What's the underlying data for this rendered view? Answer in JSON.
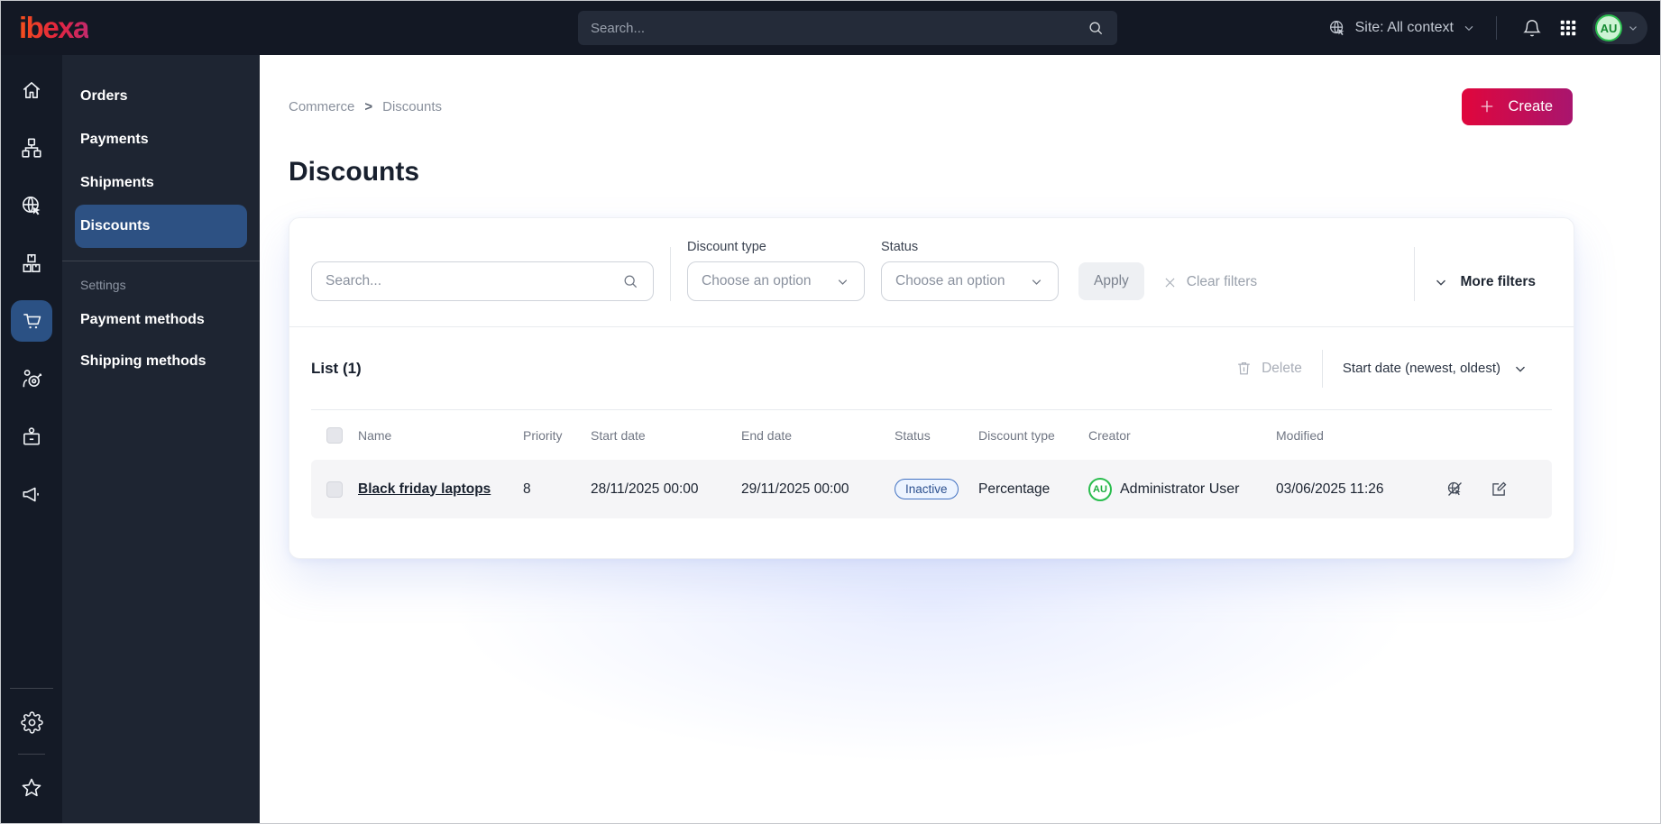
{
  "topbar": {
    "logo": "ibexa",
    "search_placeholder": "Search...",
    "site_context": "Site: All context",
    "avatar_initials": "AU"
  },
  "main_nav": {
    "items": [
      {
        "icon": "home-icon"
      },
      {
        "icon": "content-tree-icon"
      },
      {
        "icon": "site-icon"
      },
      {
        "icon": "products-icon"
      },
      {
        "icon": "commerce-cart-icon",
        "active": true
      },
      {
        "icon": "customers-target-icon"
      },
      {
        "icon": "corporate-badge-icon"
      },
      {
        "icon": "marketing-megaphone-icon"
      }
    ],
    "bottom_items": [
      {
        "icon": "settings-gear-icon"
      },
      {
        "icon": "bookmarks-star-icon"
      }
    ]
  },
  "sidebar": {
    "items": [
      {
        "label": "Orders"
      },
      {
        "label": "Payments"
      },
      {
        "label": "Shipments"
      },
      {
        "label": "Discounts",
        "active": true
      }
    ],
    "section_label": "Settings",
    "settings_items": [
      {
        "label": "Payment methods"
      },
      {
        "label": "Shipping methods"
      }
    ]
  },
  "breadcrumb": {
    "items": [
      "Commerce",
      "Discounts"
    ],
    "separator": ">"
  },
  "page": {
    "title": "Discounts",
    "create_label": "Create"
  },
  "filters": {
    "search_placeholder": "Search...",
    "discount_type_label": "Discount type",
    "discount_type_value": "Choose an option",
    "status_label": "Status",
    "status_value": "Choose an option",
    "apply_label": "Apply",
    "clear_label": "Clear filters",
    "more_filters_label": "More filters"
  },
  "list": {
    "title": "List (1)",
    "delete_label": "Delete",
    "sort_label": "Start date (newest, oldest)",
    "columns": [
      "Name",
      "Priority",
      "Start date",
      "End date",
      "Status",
      "Discount type",
      "Creator",
      "Modified"
    ],
    "rows": [
      {
        "name": "Black friday laptops",
        "priority": "8",
        "start_date": "28/11/2025 00:00",
        "end_date": "29/11/2025 00:00",
        "status": "Inactive",
        "discount_type": "Percentage",
        "creator_initials": "AU",
        "creator": "Administrator User",
        "modified": "03/06/2025 11:26"
      }
    ]
  },
  "colors": {
    "topbar_bg": "#131824",
    "sidebar_bg": "#1e2532",
    "active_nav_blue": "#2d5183",
    "brand_gradient_start": "#e0063c",
    "brand_gradient_end": "#a9156e",
    "status_inactive_border": "#4272c2",
    "status_inactive_text": "#2c508f",
    "avatar_green": "#2abd4e",
    "row_bg": "#f5f5f7"
  }
}
